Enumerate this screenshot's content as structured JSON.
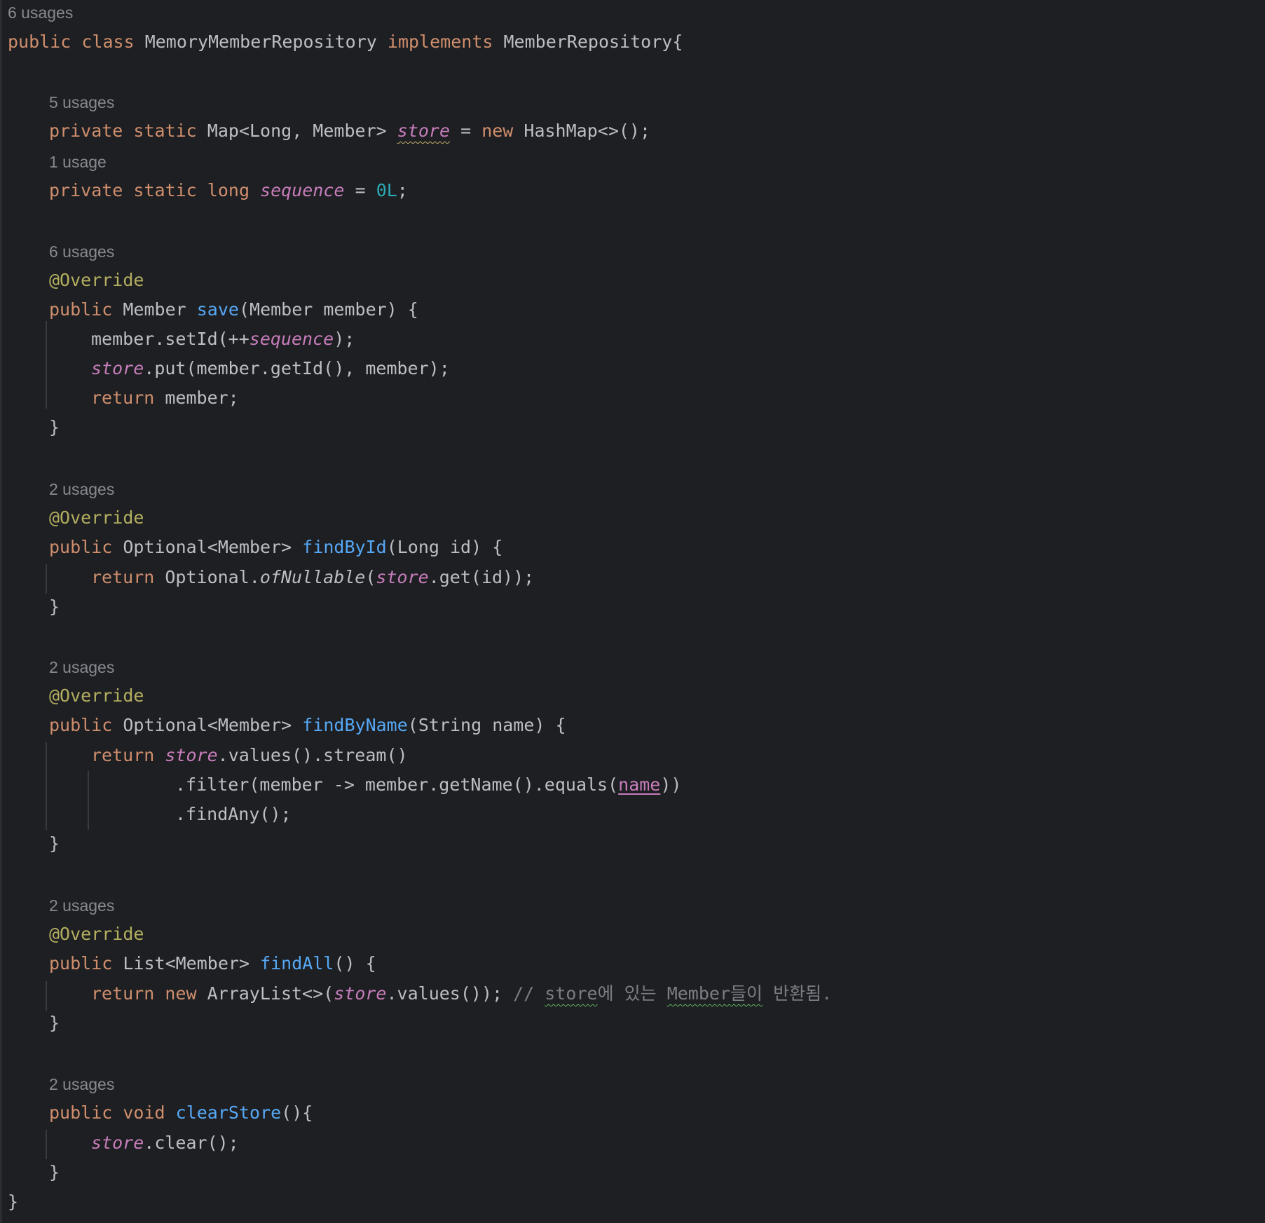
{
  "hints": {
    "class_usages": "6 usages",
    "store_usages": "5 usages",
    "sequence_usages": "1 usage",
    "save_usages": "6 usages",
    "findById_usages": "2 usages",
    "findByName_usages": "2 usages",
    "findAll_usages": "2 usages",
    "clearStore_usages": "2 usages"
  },
  "tokens": {
    "kw_public": "public",
    "kw_class": "class",
    "kw_implements": "implements",
    "kw_private": "private",
    "kw_static": "static",
    "kw_long": "long",
    "kw_new": "new",
    "kw_return": "return",
    "kw_void": "void",
    "class_name": "MemoryMemberRepository",
    "interface_name": "MemberRepository",
    "open_brace_tight": "{",
    "map_type": "Map<Long, Member>",
    "field_store": "store",
    "eq": "=",
    "hashmap_ctor": "HashMap<>();",
    "field_sequence": "sequence",
    "zero_long": "0L",
    "semicolon": ";",
    "override": "@Override",
    "member_type": "Member",
    "fn_save": "save",
    "save_params": "(Member member) {",
    "setid_prefix": "member.setId(++",
    "setid_suffix": ");",
    "put_call": ".put(member.getId(), member);",
    "member_semicolon": "member;",
    "close_brace": "}",
    "optional_member": "Optional<Member>",
    "fn_findById": "findById",
    "findById_params": "(Long id) {",
    "optional_class": "Optional.",
    "of_nullable": "ofNullable",
    "open_paren": "(",
    "get_id_call": ".get(id));",
    "fn_findByName": "findByName",
    "findByName_params": "(String name) {",
    "values_stream": ".values().stream()",
    "filter_prefix": ".filter(member -> member.getName().equals(",
    "param_name": "name",
    "filter_suffix": "))",
    "find_any": ".findAny();",
    "list_member": "List<Member>",
    "fn_findAll": "findAll",
    "empty_params_brace": "() {",
    "arraylist_ctor": "ArrayList<>(",
    "values_close": ".values());",
    "comment_slash": "//",
    "comment_store": "store",
    "comment_ko1": "에 있는",
    "comment_member": "Member",
    "comment_ko2": "들이",
    "comment_ko3": "반환됨.",
    "fn_clearStore": "clearStore",
    "empty_params_tight": "(){",
    "clear_call": ".clear();"
  }
}
